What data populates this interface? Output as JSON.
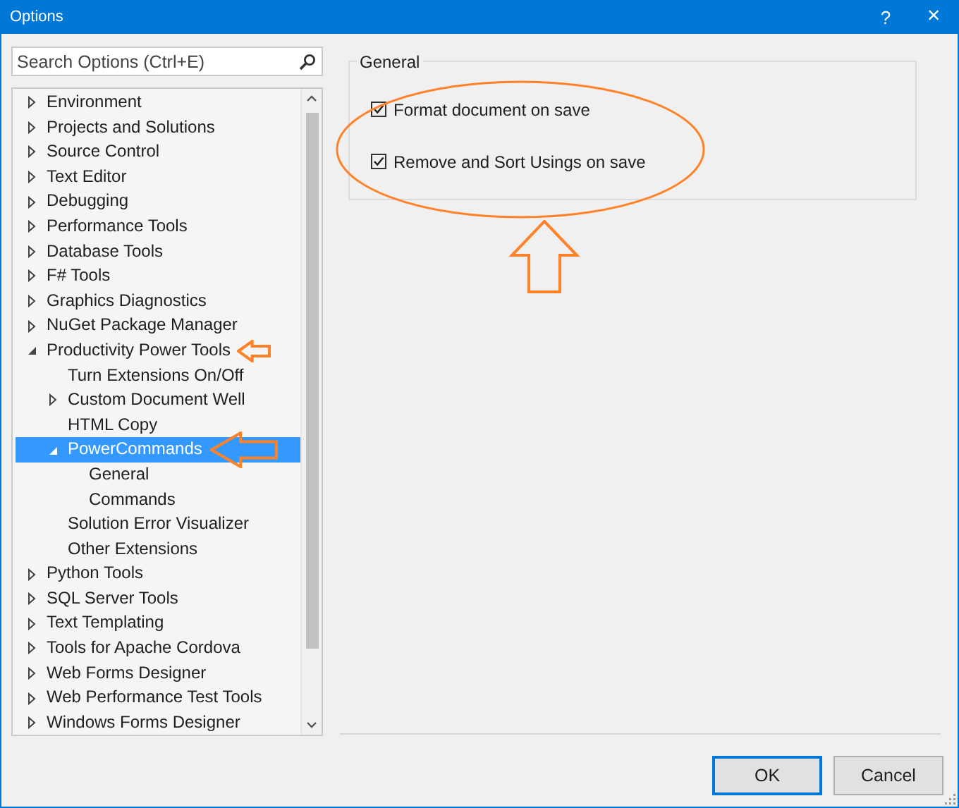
{
  "window": {
    "title": "Options",
    "buttons": [
      {
        "kind": "help",
        "label": "?"
      },
      {
        "kind": "close",
        "label": "×"
      }
    ]
  },
  "search": {
    "placeholder": "Search Options (Ctrl+E)"
  },
  "tree": {
    "items": [
      {
        "label": "Environment",
        "expanded": false,
        "selected": false
      },
      {
        "label": "Projects and Solutions",
        "expanded": false,
        "selected": false
      },
      {
        "label": "Source Control",
        "expanded": false,
        "selected": false
      },
      {
        "label": "Text Editor",
        "expanded": false,
        "selected": false
      },
      {
        "label": "Debugging",
        "expanded": false,
        "selected": false
      },
      {
        "label": "Performance Tools",
        "expanded": false,
        "selected": false
      },
      {
        "label": "Database Tools",
        "expanded": false,
        "selected": false
      },
      {
        "label": "F# Tools",
        "expanded": false,
        "selected": false
      },
      {
        "label": "Graphics Diagnostics",
        "expanded": false,
        "selected": false
      },
      {
        "label": "NuGet Package Manager",
        "expanded": false,
        "selected": false
      },
      {
        "label": "Productivity Power Tools",
        "expanded": true,
        "selected": false,
        "callout": true,
        "children": [
          {
            "label": "Turn Extensions On/Off",
            "selected": false
          },
          {
            "label": "Custom Document Well",
            "expanded": false,
            "selected": false
          },
          {
            "label": "HTML Copy",
            "selected": false
          },
          {
            "label": "PowerCommands",
            "expanded": true,
            "selected": true,
            "callout": true,
            "children": [
              {
                "label": "General",
                "selected": false
              },
              {
                "label": "Commands",
                "selected": false
              }
            ]
          },
          {
            "label": "Solution Error Visualizer",
            "selected": false
          },
          {
            "label": "Other Extensions",
            "selected": false
          }
        ]
      },
      {
        "label": "Python Tools",
        "expanded": false,
        "selected": false
      },
      {
        "label": "SQL Server Tools",
        "expanded": false,
        "selected": false
      },
      {
        "label": "Text Templating",
        "expanded": false,
        "selected": false
      },
      {
        "label": "Tools for Apache Cordova",
        "expanded": false,
        "selected": false
      },
      {
        "label": "Web Forms Designer",
        "expanded": false,
        "selected": false
      },
      {
        "label": "Web Performance Test Tools",
        "expanded": false,
        "selected": false
      },
      {
        "label": "Windows Forms Designer",
        "expanded": false,
        "selected": false
      }
    ]
  },
  "group": {
    "title": "General",
    "circled": true,
    "pointer": true,
    "options": [
      {
        "label": "Format document on save",
        "checked": true
      },
      {
        "label": "Remove and Sort Usings on save",
        "checked": true
      }
    ]
  },
  "buttons": [
    {
      "label": "OK",
      "default": true
    },
    {
      "label": "Cancel",
      "default": false
    }
  ]
}
